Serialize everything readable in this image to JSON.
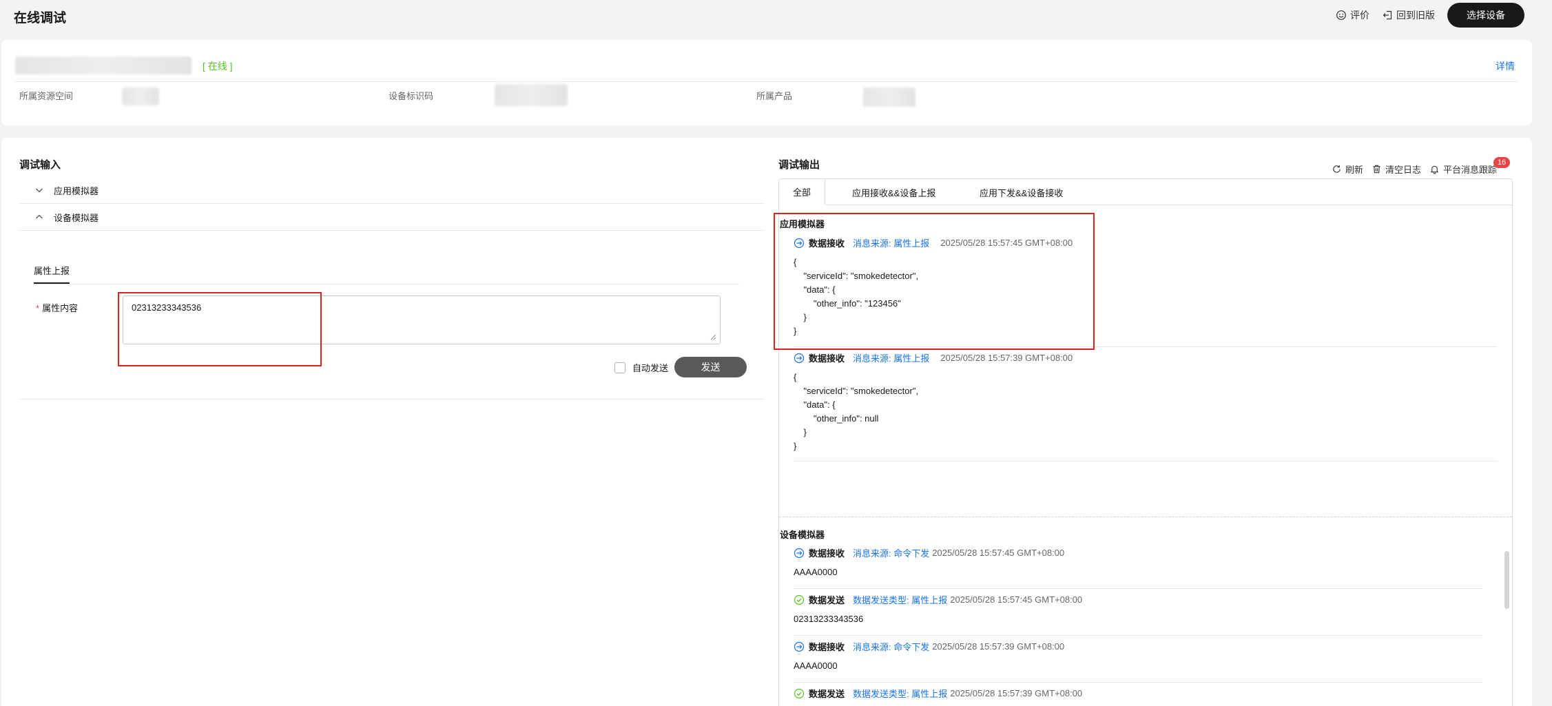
{
  "header": {
    "title": "在线调试",
    "rate_label": "评价",
    "back_label": "回到旧版",
    "select_device_label": "选择设备"
  },
  "device": {
    "status": "[ 在线 ]",
    "detail_label": "详情",
    "resource_space_label": "所属资源空间",
    "device_id_label": "设备标识码",
    "product_label": "所属产品"
  },
  "debug_input": {
    "title": "调试输入",
    "app_simulator": "应用模拟器",
    "device_simulator": "设备模拟器",
    "tab_label": "属性上报",
    "field_required": "*",
    "field_label": "属性内容",
    "field_value": "02313233343536",
    "auto_send_label": "自动发送",
    "send_label": "发送"
  },
  "debug_output": {
    "title": "调试输出",
    "refresh_label": "刷新",
    "clear_label": "清空日志",
    "trace_label": "平台消息跟踪",
    "badge_count": "16",
    "tabs": [
      "全部",
      "应用接收&&设备上报",
      "应用下发&&设备接收"
    ],
    "app_group_title": "应用模拟器",
    "app_logs": [
      {
        "type": "数据接收",
        "source": "消息来源: 属性上报",
        "time": "2025/05/28 15:57:45 GMT+08:00",
        "body": "{\n    \"serviceId\": \"smokedetector\",\n    \"data\": {\n        \"other_info\": \"123456\"\n    }\n}"
      },
      {
        "type": "数据接收",
        "source": "消息来源: 属性上报",
        "time": "2025/05/28 15:57:39 GMT+08:00",
        "body": "{\n    \"serviceId\": \"smokedetector\",\n    \"data\": {\n        \"other_info\": null\n    }\n}"
      }
    ],
    "device_group_title": "设备模拟器",
    "device_logs": [
      {
        "type": "数据接收",
        "source": "消息来源: 命令下发",
        "time": "2025/05/28 15:57:45 GMT+08:00",
        "body": "AAAA0000",
        "kind": "receive"
      },
      {
        "type": "数据发送",
        "source": "数据发送类型: 属性上报",
        "time": "2025/05/28 15:57:45 GMT+08:00",
        "body": "02313233343536",
        "kind": "send"
      },
      {
        "type": "数据接收",
        "source": "消息来源: 命令下发",
        "time": "2025/05/28 15:57:39 GMT+08:00",
        "body": "AAAA0000",
        "kind": "receive"
      },
      {
        "type": "数据发送",
        "source": "数据发送类型: 属性上报",
        "time": "2025/05/28 15:57:39 GMT+08:00",
        "body": "",
        "kind": "send"
      }
    ]
  },
  "colors": {
    "link": "#1a73e8",
    "online": "#52c41a",
    "highlight": "#e0211b",
    "badge": "#e54545"
  }
}
